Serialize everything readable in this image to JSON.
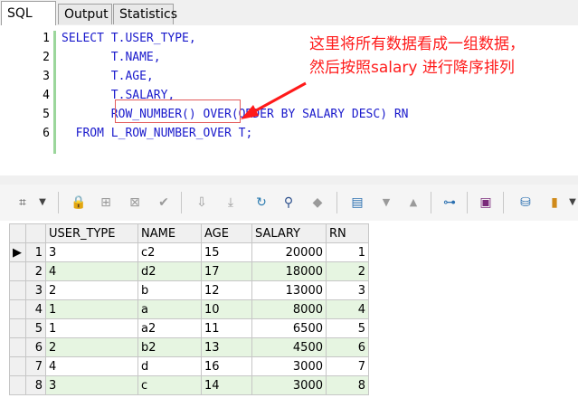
{
  "tabs": [
    {
      "label": "SQL",
      "active": true
    },
    {
      "label": "Output",
      "active": false
    },
    {
      "label": "Statistics",
      "active": false
    }
  ],
  "editor": {
    "line_numbers": [
      "1",
      "2",
      "3",
      "4",
      "5",
      "6"
    ],
    "lines": [
      "SELECT T.USER_TYPE,",
      "       T.NAME,",
      "       T.AGE,",
      "       T.SALARY,",
      "       ROW_NUMBER() OVER(ORDER BY SALARY DESC) RN",
      "  FROM L_ROW_NUMBER_OVER T;"
    ],
    "annotation_line1": "这里将所有数据看成一组数据，",
    "annotation_line2": "然后按照salary 进行降序排列",
    "annotation_color": "#ff1a1a"
  },
  "toolbar": {
    "icons": [
      "grid-options-icon",
      "dropdown-icon",
      "lock-icon",
      "insert-row-icon",
      "delete-row-icon",
      "post-check-icon",
      "move-first-icon",
      "move-last-icon",
      "refresh-icon",
      "find-icon",
      "clear-icon",
      "save-results-icon",
      "sort-descending-icon",
      "sort-ascending-icon",
      "tree-view-icon",
      "save-icon",
      "export-icon",
      "chart-icon",
      "more-icon"
    ]
  },
  "grid": {
    "columns": [
      "USER_TYPE",
      "NAME",
      "AGE",
      "SALARY",
      "RN"
    ],
    "current_row_marker": "▶",
    "rows": [
      {
        "n": "1",
        "cells": [
          "3",
          "c2",
          "15",
          "20000",
          "1"
        ]
      },
      {
        "n": "2",
        "cells": [
          "4",
          "d2",
          "17",
          "18000",
          "2"
        ]
      },
      {
        "n": "3",
        "cells": [
          "2",
          "b",
          "12",
          "13000",
          "3"
        ]
      },
      {
        "n": "4",
        "cells": [
          "1",
          "a",
          "10",
          "8000",
          "4"
        ]
      },
      {
        "n": "5",
        "cells": [
          "1",
          "a2",
          "11",
          "6500",
          "5"
        ]
      },
      {
        "n": "6",
        "cells": [
          "2",
          "b2",
          "13",
          "4500",
          "6"
        ]
      },
      {
        "n": "7",
        "cells": [
          "4",
          "d",
          "16",
          "3000",
          "7"
        ]
      },
      {
        "n": "8",
        "cells": [
          "3",
          "c",
          "14",
          "3000",
          "8"
        ]
      }
    ],
    "row_alt_color": "#e6f5e1"
  }
}
